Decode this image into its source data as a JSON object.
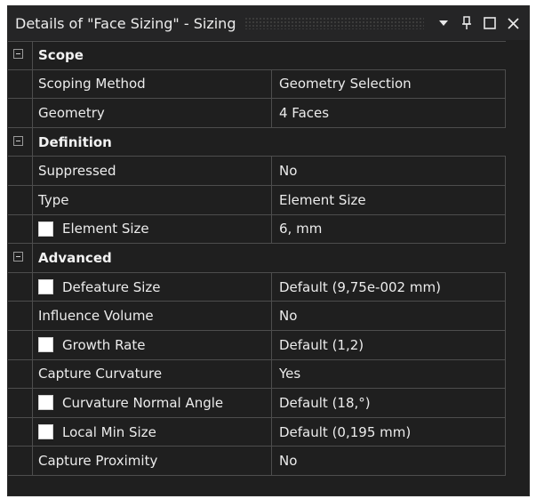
{
  "panel": {
    "title": "Details of \"Face Sizing\" - Sizing",
    "buttons": {
      "dropdown": "▾",
      "pin": "⫯",
      "maximize": "☐",
      "close": "✕"
    }
  },
  "sections": [
    {
      "name": "Scope",
      "rows": [
        {
          "label": "Scoping Method",
          "value": "Geometry Selection",
          "checkbox": false
        },
        {
          "label": "Geometry",
          "value": "4 Faces",
          "checkbox": false
        }
      ]
    },
    {
      "name": "Definition",
      "rows": [
        {
          "label": "Suppressed",
          "value": "No",
          "checkbox": false
        },
        {
          "label": "Type",
          "value": "Element Size",
          "checkbox": false
        },
        {
          "label": "Element Size",
          "value": "6, mm",
          "checkbox": true
        }
      ]
    },
    {
      "name": "Advanced",
      "rows": [
        {
          "label": "Defeature Size",
          "value": "Default (9,75e-002 mm)",
          "checkbox": true
        },
        {
          "label": "Influence Volume",
          "value": "No",
          "checkbox": false
        },
        {
          "label": "Growth Rate",
          "value": "Default (1,2)",
          "checkbox": true
        },
        {
          "label": "Capture Curvature",
          "value": "Yes",
          "checkbox": false
        },
        {
          "label": "Curvature Normal Angle",
          "value": "Default (18,°)",
          "checkbox": true
        },
        {
          "label": "Local Min Size",
          "value": "Default (0,195 mm)",
          "checkbox": true
        },
        {
          "label": "Capture Proximity",
          "value": "No",
          "checkbox": false
        }
      ]
    }
  ]
}
